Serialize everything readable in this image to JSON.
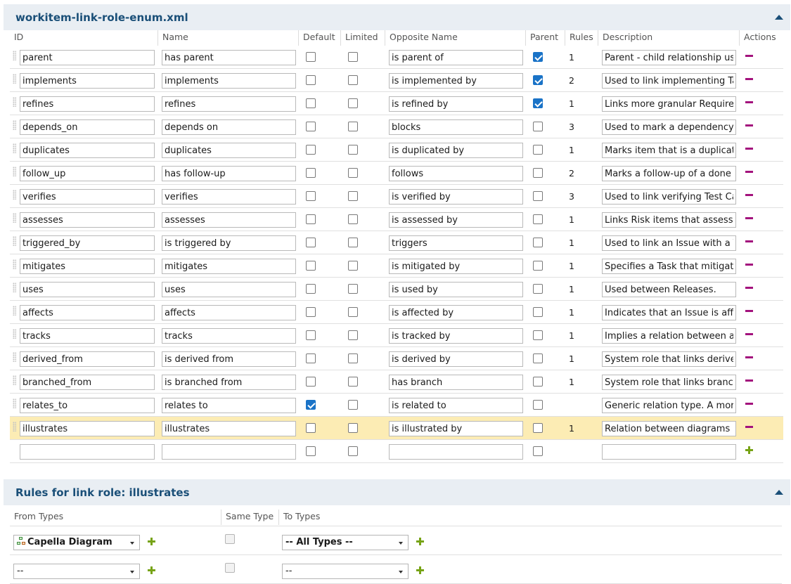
{
  "enum_panel": {
    "title": "workitem-link-role-enum.xml",
    "columns": [
      "ID",
      "Name",
      "Default",
      "Limited",
      "Opposite Name",
      "Parent",
      "Rules",
      "Description",
      "Actions"
    ],
    "rows": [
      {
        "id": "parent",
        "name": "has parent",
        "default": false,
        "limited": false,
        "opposite": "is parent of",
        "parent": true,
        "rules": "1",
        "description": "Parent - child relationship used"
      },
      {
        "id": "implements",
        "name": "implements",
        "default": false,
        "limited": false,
        "opposite": "is implemented by",
        "parent": true,
        "rules": "2",
        "description": "Used to link implementing Task"
      },
      {
        "id": "refines",
        "name": "refines",
        "default": false,
        "limited": false,
        "opposite": "is refined by",
        "parent": true,
        "rules": "1",
        "description": "Links more granular Requireme"
      },
      {
        "id": "depends_on",
        "name": "depends on",
        "default": false,
        "limited": false,
        "opposite": "blocks",
        "parent": false,
        "rules": "3",
        "description": "Used to mark a dependency be"
      },
      {
        "id": "duplicates",
        "name": "duplicates",
        "default": false,
        "limited": false,
        "opposite": "is duplicated by",
        "parent": false,
        "rules": "1",
        "description": "Marks item that is a duplicate o"
      },
      {
        "id": "follow_up",
        "name": "has follow-up",
        "default": false,
        "limited": false,
        "opposite": "follows",
        "parent": false,
        "rules": "2",
        "description": "Marks a follow-up of a done ite"
      },
      {
        "id": "verifies",
        "name": "verifies",
        "default": false,
        "limited": false,
        "opposite": "is verified by",
        "parent": false,
        "rules": "3",
        "description": "Used to link verifying Test Cases"
      },
      {
        "id": "assesses",
        "name": "assesses",
        "default": false,
        "limited": false,
        "opposite": "is assessed by",
        "parent": false,
        "rules": "1",
        "description": "Links Risk items that assess Req"
      },
      {
        "id": "triggered_by",
        "name": "is triggered by",
        "default": false,
        "limited": false,
        "opposite": "triggers",
        "parent": false,
        "rules": "1",
        "description": "Used to link an Issue with a Test"
      },
      {
        "id": "mitigates",
        "name": "mitigates",
        "default": false,
        "limited": false,
        "opposite": "is mitigated by",
        "parent": false,
        "rules": "1",
        "description": "Specifies a Task that mitigates a"
      },
      {
        "id": "uses",
        "name": "uses",
        "default": false,
        "limited": false,
        "opposite": "is used by",
        "parent": false,
        "rules": "1",
        "description": "Used between Releases."
      },
      {
        "id": "affects",
        "name": "affects",
        "default": false,
        "limited": false,
        "opposite": "is affected by",
        "parent": false,
        "rules": "1",
        "description": "Indicates that an Issue is affectir"
      },
      {
        "id": "tracks",
        "name": "tracks",
        "default": false,
        "limited": false,
        "opposite": "is tracked by",
        "parent": false,
        "rules": "1",
        "description": "Implies a relation between a Ch"
      },
      {
        "id": "derived_from",
        "name": "is derived from",
        "default": false,
        "limited": false,
        "opposite": "is derived by",
        "parent": false,
        "rules": "1",
        "description": "System role that links derived it"
      },
      {
        "id": "branched_from",
        "name": "is branched from",
        "default": false,
        "limited": false,
        "opposite": "has branch",
        "parent": false,
        "rules": "1",
        "description": "System role that links branched"
      },
      {
        "id": "relates_to",
        "name": "relates to",
        "default": true,
        "limited": false,
        "opposite": "is related to",
        "parent": false,
        "rules": "",
        "description": "Generic relation type. A more co"
      },
      {
        "id": "illustrates",
        "name": "illustrates",
        "default": false,
        "limited": false,
        "opposite": "is illustrated by",
        "parent": false,
        "rules": "1",
        "description": "Relation between diagrams and",
        "selected": true
      },
      {
        "id": "",
        "name": "",
        "default": false,
        "limited": false,
        "opposite": "",
        "parent": false,
        "rules": "",
        "description": "",
        "is_new": true
      }
    ]
  },
  "rules_panel": {
    "title": "Rules for link role: illustrates",
    "columns": [
      "From Types",
      "Same Type",
      "To Types"
    ],
    "rows": [
      {
        "from": "Capella Diagram",
        "from_icon": "diagram-icon",
        "same_type": false,
        "to": "-- All Types --"
      },
      {
        "from": "--",
        "same_type": false,
        "to": "--"
      }
    ]
  },
  "colors": {
    "header_bg": "#e9eef3",
    "title": "#1a4f78",
    "selected_row": "#fcecb4",
    "remove_icon": "#a3127d",
    "add_icon": "#77a316",
    "checkbox_checked": "#1a73c7"
  }
}
